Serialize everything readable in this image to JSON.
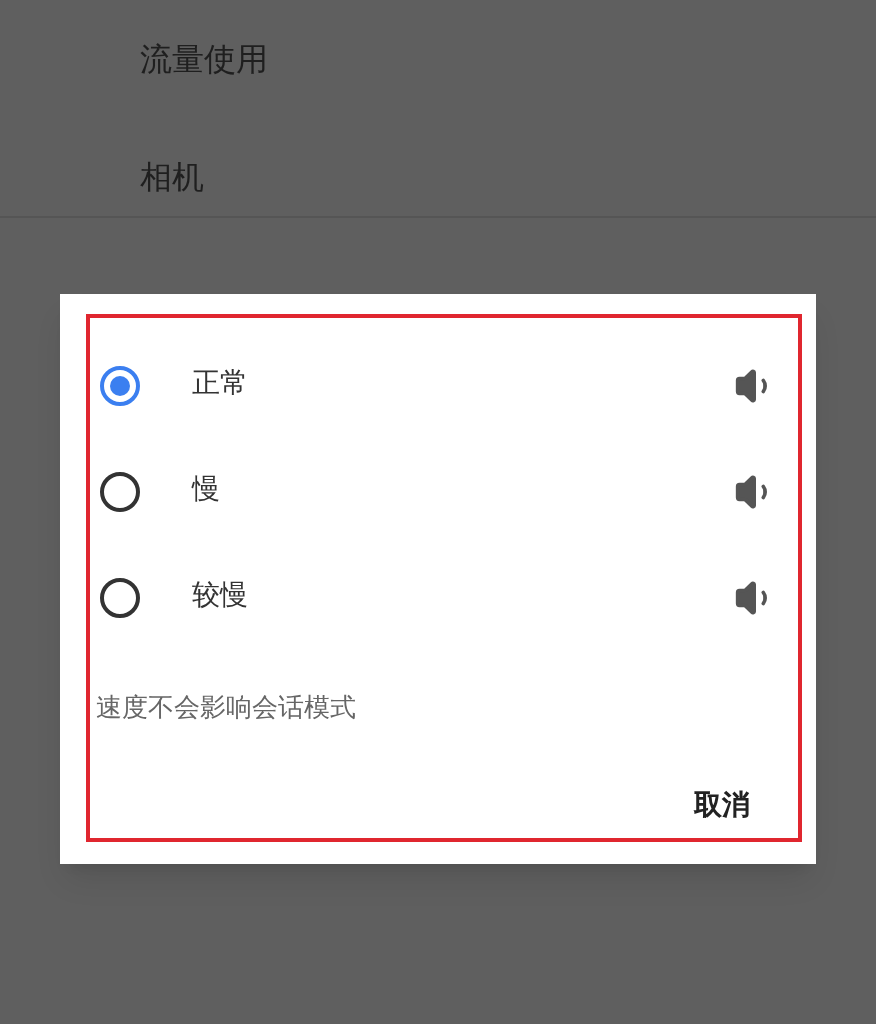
{
  "settings": {
    "items": [
      "流量使用",
      "相机"
    ]
  },
  "dialog": {
    "options": [
      {
        "label": "正常",
        "selected": true
      },
      {
        "label": "慢",
        "selected": false
      },
      {
        "label": "较慢",
        "selected": false
      }
    ],
    "note": "速度不会影响会话模式",
    "cancel_button": "取消"
  }
}
